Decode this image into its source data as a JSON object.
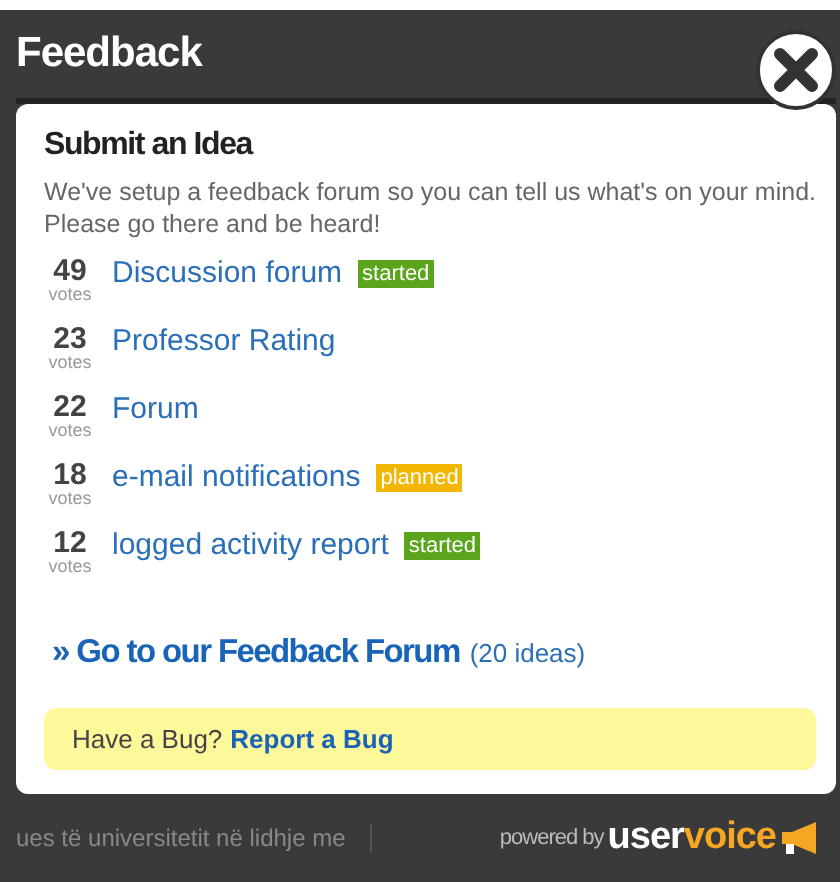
{
  "window": {
    "title": "Feedback"
  },
  "card": {
    "heading": "Submit an Idea",
    "intro": "We've setup a feedback forum so you can tell us what's on your mind. Please go there and be heard!",
    "ideas": [
      {
        "votes": "49",
        "votes_label": "votes",
        "title": "Discussion forum",
        "status": {
          "label": "started",
          "color": "#5aa51c"
        }
      },
      {
        "votes": "23",
        "votes_label": "votes",
        "title": "Professor Rating"
      },
      {
        "votes": "22",
        "votes_label": "votes",
        "title": "Forum"
      },
      {
        "votes": "18",
        "votes_label": "votes",
        "title": "e-mail notifications",
        "status": {
          "label": "planned",
          "color": "#f2b705"
        }
      },
      {
        "votes": "12",
        "votes_label": "votes",
        "title": "logged activity report",
        "status": {
          "label": "started",
          "color": "#5aa51c"
        }
      }
    ],
    "forum_link": "» Go to our Feedback Forum",
    "forum_count": "(20 ideas)",
    "bug_prompt": "Have a Bug?",
    "bug_link": "Report a Bug"
  },
  "footer": {
    "background_text": "ues të universitetit në lidhje me",
    "powered_by": "powered by",
    "brand_user": "user",
    "brand_voice": "voice"
  }
}
